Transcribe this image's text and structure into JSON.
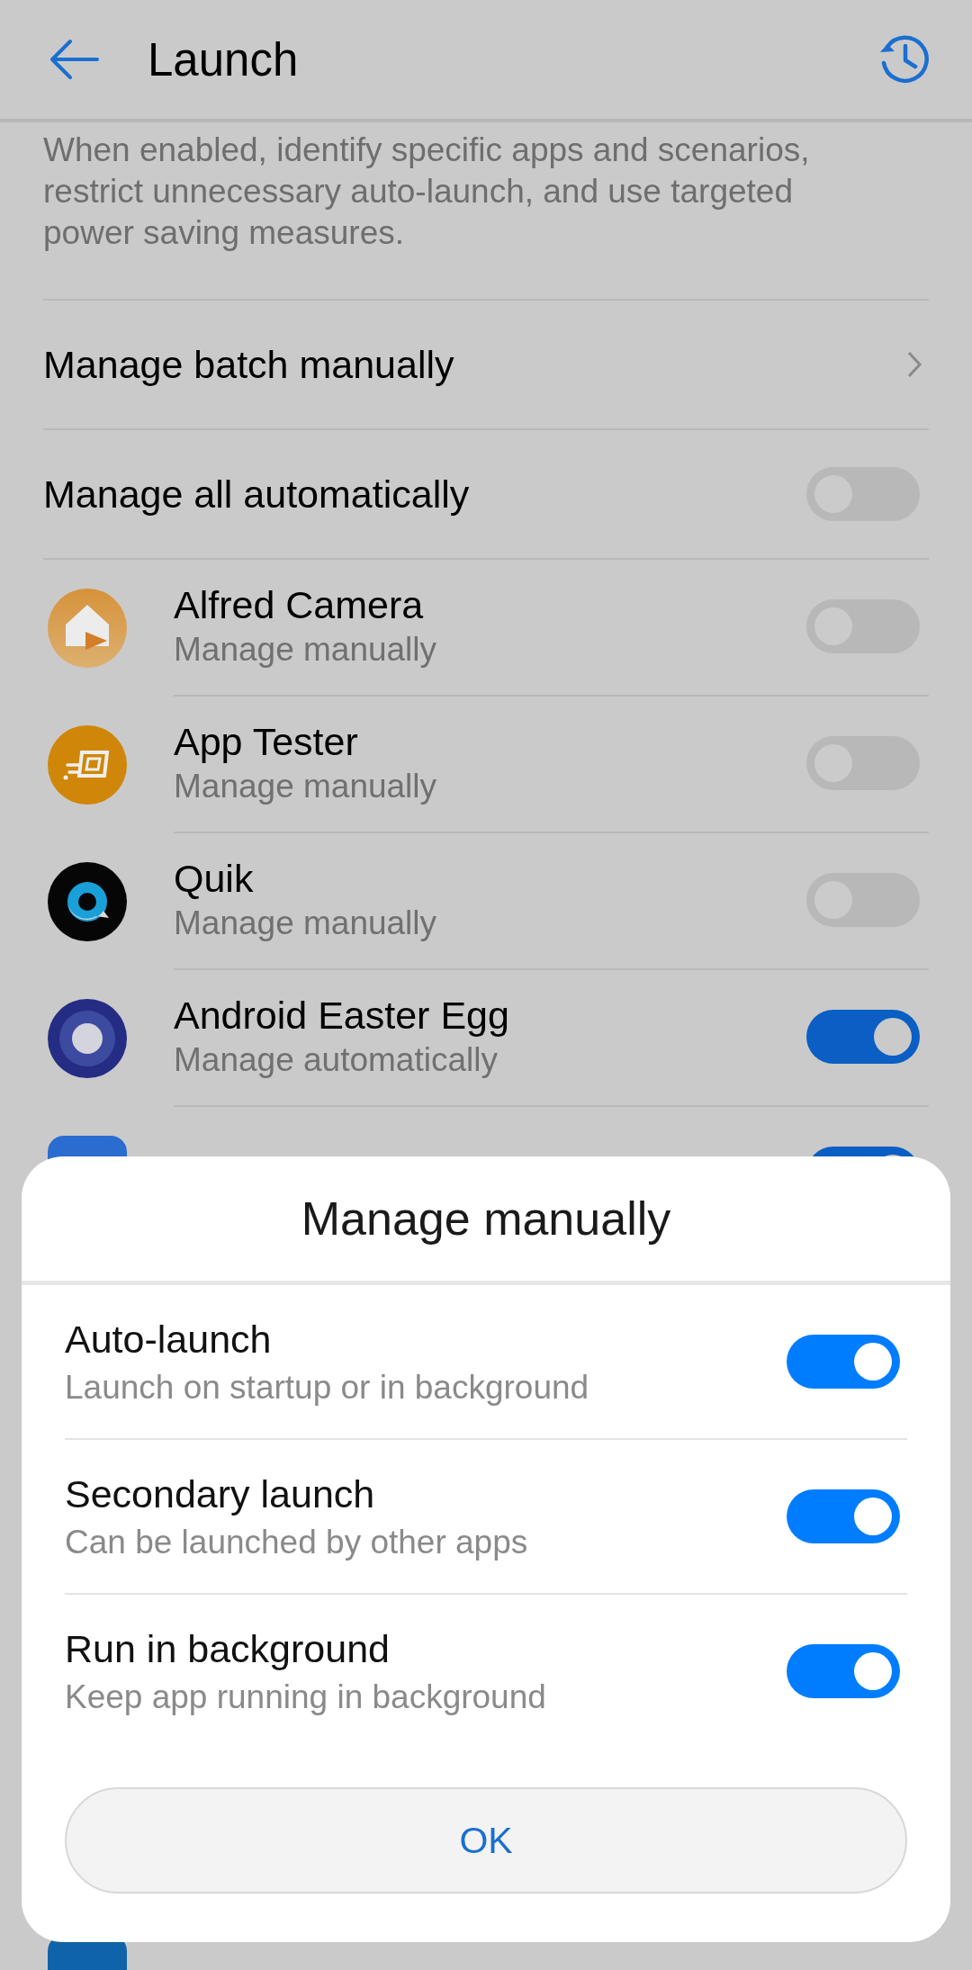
{
  "header": {
    "title": "Launch"
  },
  "description": "When enabled, identify specific apps and scenarios, restrict unnecessary auto-launch, and use targeted power saving measures.",
  "settings": [
    {
      "kind": "link",
      "label": "Manage batch manually"
    },
    {
      "kind": "switch",
      "label": "Manage all automatically",
      "on": false
    }
  ],
  "apps": [
    {
      "name": "Alfred Camera",
      "status": "Manage manually",
      "on": false
    },
    {
      "name": "App Tester",
      "status": "Manage manually",
      "on": false
    },
    {
      "name": "Quik",
      "status": "Manage manually",
      "on": false
    },
    {
      "name": "Android Easter Egg",
      "status": "Manage automatically",
      "on": true
    },
    {
      "on": true
    }
  ],
  "dialog": {
    "title": "Manage manually",
    "options": [
      {
        "label": "Auto-launch",
        "description": "Launch on startup or in background",
        "on": true
      },
      {
        "label": "Secondary launch",
        "description": "Can be launched by other apps",
        "on": true
      },
      {
        "label": "Run in background",
        "description": "Keep app running in background",
        "on": true
      }
    ],
    "button": "OK"
  }
}
